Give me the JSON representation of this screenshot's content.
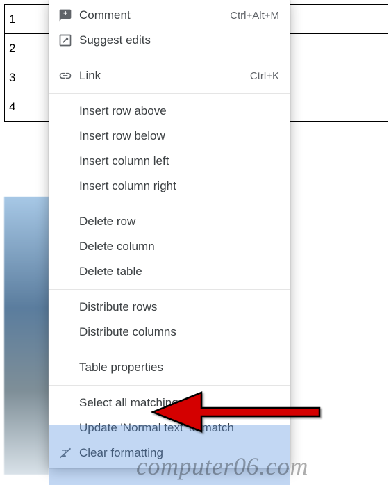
{
  "table": {
    "rows": [
      "1",
      "2",
      "3",
      "4"
    ]
  },
  "menu": {
    "comment": {
      "label": "Comment",
      "shortcut": "Ctrl+Alt+M"
    },
    "suggest": {
      "label": "Suggest edits"
    },
    "link": {
      "label": "Link",
      "shortcut": "Ctrl+K"
    },
    "row_above": {
      "label": "Insert row above"
    },
    "row_below": {
      "label": "Insert row below"
    },
    "col_left": {
      "label": "Insert column left"
    },
    "col_right": {
      "label": "Insert column right"
    },
    "del_row": {
      "label": "Delete row"
    },
    "del_col": {
      "label": "Delete column"
    },
    "del_table": {
      "label": "Delete table"
    },
    "dist_rows": {
      "label": "Distribute rows"
    },
    "dist_cols": {
      "label": "Distribute columns"
    },
    "table_props": {
      "label": "Table properties"
    },
    "select_match": {
      "label": "Select all matching text"
    },
    "update_normal": {
      "label": "Update 'Normal text' to match"
    },
    "clear_fmt": {
      "label": "Clear formatting"
    }
  },
  "annotation": {
    "arrow_color": "#d40000",
    "target": "table-properties"
  },
  "watermark": "computer06.com"
}
